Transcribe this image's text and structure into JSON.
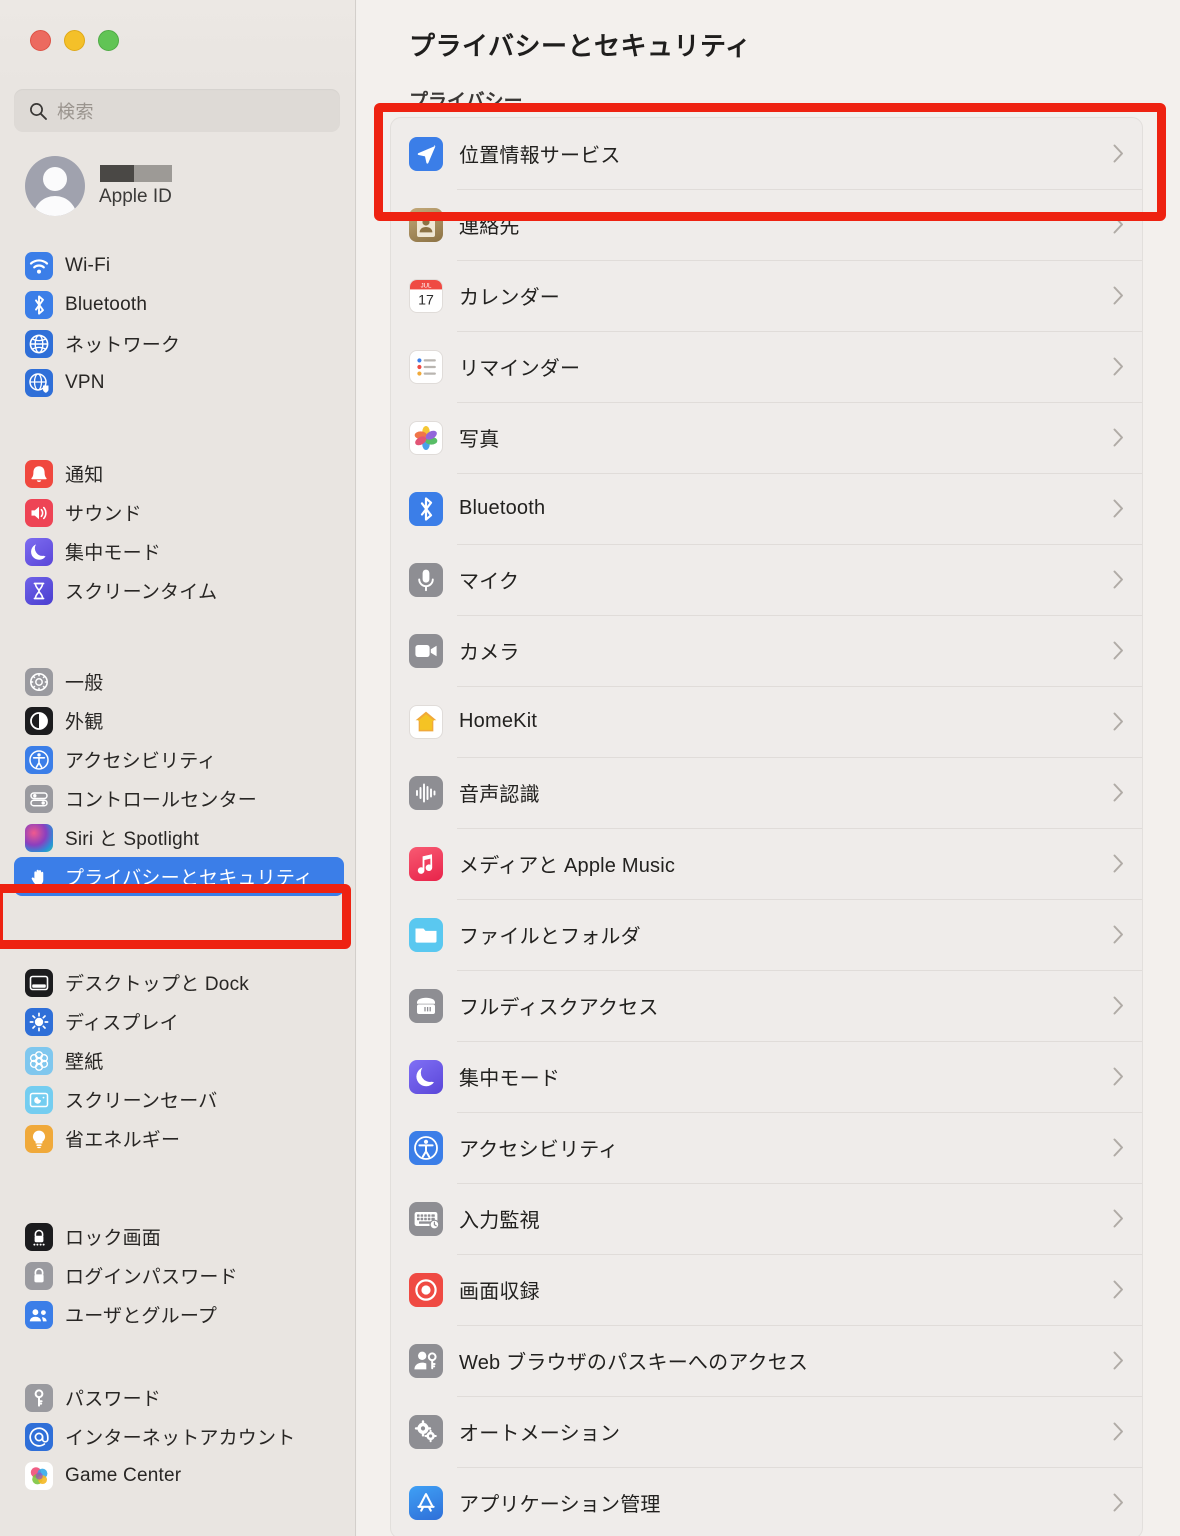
{
  "window": {
    "traffic_lights": [
      "close",
      "minimize",
      "zoom"
    ]
  },
  "search": {
    "placeholder": "検索",
    "value": "",
    "icon": "search-icon"
  },
  "account": {
    "name_redacted": true,
    "label": "Apple ID",
    "avatar_icon": "person-avatar-icon"
  },
  "sidebar": {
    "groups": [
      {
        "items": [
          {
            "label": "Wi-Fi",
            "icon": "wifi-icon",
            "color": "#3b7ee8"
          },
          {
            "label": "Bluetooth",
            "icon": "bluetooth-icon",
            "color": "#3b7ee8"
          },
          {
            "label": "ネットワーク",
            "icon": "globe-icon",
            "color": "#2f6fd8"
          },
          {
            "label": "VPN",
            "icon": "vpn-globe-icon",
            "color": "#2f6fd8"
          }
        ]
      },
      {
        "items": [
          {
            "label": "通知",
            "icon": "bell-icon",
            "color": "#f0483e"
          },
          {
            "label": "サウンド",
            "icon": "speaker-icon",
            "color": "#ee4455"
          },
          {
            "label": "集中モード",
            "icon": "moon-icon",
            "color": "#6a5ae0"
          },
          {
            "label": "スクリーンタイム",
            "icon": "hourglass-icon",
            "color": "#5b52dd"
          }
        ]
      },
      {
        "items": [
          {
            "label": "一般",
            "icon": "gear-icon",
            "color": "#9a9a9f"
          },
          {
            "label": "外観",
            "icon": "appearance-icon",
            "color": "#1c1c1e"
          },
          {
            "label": "アクセシビリティ",
            "icon": "accessibility-icon",
            "color": "#3b7ee8"
          },
          {
            "label": "コントロールセンター",
            "icon": "control-center-icon",
            "color": "#9a9a9f"
          },
          {
            "label": "Siri と Spotlight",
            "icon": "siri-icon",
            "color": "#7a4ea8"
          },
          {
            "label": "プライバシーとセキュリティ",
            "icon": "hand-raised-icon",
            "color": "#3b7ee8",
            "selected": true
          }
        ]
      },
      {
        "items": [
          {
            "label": "デスクトップと Dock",
            "icon": "desktop-dock-icon",
            "color": "#1c1c1e"
          },
          {
            "label": "ディスプレイ",
            "icon": "brightness-icon",
            "color": "#2f6fd8"
          },
          {
            "label": "壁紙",
            "icon": "wallpaper-icon",
            "color": "#7fc7ee"
          },
          {
            "label": "スクリーンセーバ",
            "icon": "screensaver-icon",
            "color": "#74cdf0"
          },
          {
            "label": "省エネルギー",
            "icon": "lightbulb-icon",
            "color": "#f0a93a"
          }
        ]
      },
      {
        "items": [
          {
            "label": "ロック画面",
            "icon": "lock-screen-icon",
            "color": "#1c1c1e"
          },
          {
            "label": "ログインパスワード",
            "icon": "padlock-icon",
            "color": "#9a9a9f"
          },
          {
            "label": "ユーザとグループ",
            "icon": "users-icon",
            "color": "#3b7ee8"
          }
        ]
      },
      {
        "items": [
          {
            "label": "パスワード",
            "icon": "key-icon",
            "color": "#9a9a9f"
          },
          {
            "label": "インターネットアカウント",
            "icon": "at-sign-icon",
            "color": "#2f6fd8"
          },
          {
            "label": "Game Center",
            "icon": "game-center-icon",
            "color": "#ffffff"
          }
        ]
      }
    ]
  },
  "main": {
    "title": "プライバシーとセキュリティ",
    "section_label": "プライバシー",
    "rows": [
      {
        "label": "位置情報サービス",
        "icon": "location-arrow-icon",
        "color": "#3b7ee8",
        "highlighted": true
      },
      {
        "label": "連絡先",
        "icon": "contacts-icon",
        "color": "#a78b5d"
      },
      {
        "label": "カレンダー",
        "icon": "calendar-icon",
        "color": "#ffffff"
      },
      {
        "label": "リマインダー",
        "icon": "reminders-icon",
        "color": "#ffffff"
      },
      {
        "label": "写真",
        "icon": "photos-icon",
        "color": "#ffffff"
      },
      {
        "label": "Bluetooth",
        "icon": "bluetooth-icon",
        "color": "#3b7ee8"
      },
      {
        "label": "マイク",
        "icon": "microphone-icon",
        "color": "#8e8e93"
      },
      {
        "label": "カメラ",
        "icon": "camera-icon",
        "color": "#8e8e93"
      },
      {
        "label": "HomeKit",
        "icon": "homekit-icon",
        "color": "#ffffff"
      },
      {
        "label": "音声認識",
        "icon": "speech-recognition-icon",
        "color": "#8e8e93"
      },
      {
        "label": "メディアと Apple Music",
        "icon": "music-note-icon",
        "color": "#f0405a"
      },
      {
        "label": "ファイルとフォルダ",
        "icon": "folder-icon",
        "color": "#5ac8f0"
      },
      {
        "label": "フルディスクアクセス",
        "icon": "hard-disk-icon",
        "color": "#8e8e93"
      },
      {
        "label": "集中モード",
        "icon": "moon-icon",
        "color": "#6a5ae0"
      },
      {
        "label": "アクセシビリティ",
        "icon": "accessibility-icon",
        "color": "#3b7ee8"
      },
      {
        "label": "入力監視",
        "icon": "keyboard-icon",
        "color": "#8e8e93"
      },
      {
        "label": "画面収録",
        "icon": "screen-recording-icon",
        "color": "#ef4a43"
      },
      {
        "label": "Web ブラウザのパスキーへのアクセス",
        "icon": "passkey-person-icon",
        "color": "#8e8e93"
      },
      {
        "label": "オートメーション",
        "icon": "automation-gears-icon",
        "color": "#8e8e93"
      },
      {
        "label": "アプリケーション管理",
        "icon": "app-store-icon",
        "color": "#3b7ee8"
      }
    ],
    "chevron_icon": "chevron-right-icon"
  },
  "annotations": {
    "color": "#ee2211",
    "boxes": [
      {
        "name": "highlight-location-services",
        "target": "位置情報サービス"
      },
      {
        "name": "highlight-privacy-security-sidebar",
        "target": "プライバシーとセキュリティ"
      }
    ]
  }
}
